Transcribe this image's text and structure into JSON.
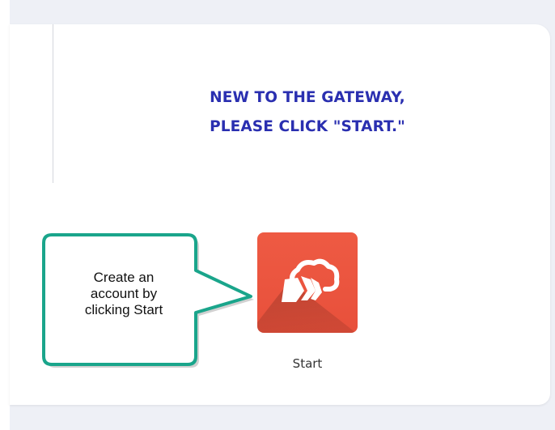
{
  "heading": {
    "line1": "NEW TO THE GATEWAY,",
    "line2": "PLEASE CLICK \"START.\""
  },
  "start_tile": {
    "label": "Start",
    "icon": "cloud-forward-icon",
    "color": "#e8503b"
  },
  "callout": {
    "line1": "Create an",
    "line2": "account by",
    "line3": "clicking Start",
    "border_color": "#1aa58b"
  },
  "colors": {
    "heading": "#2a2fb0",
    "background": "#eef0f6"
  }
}
